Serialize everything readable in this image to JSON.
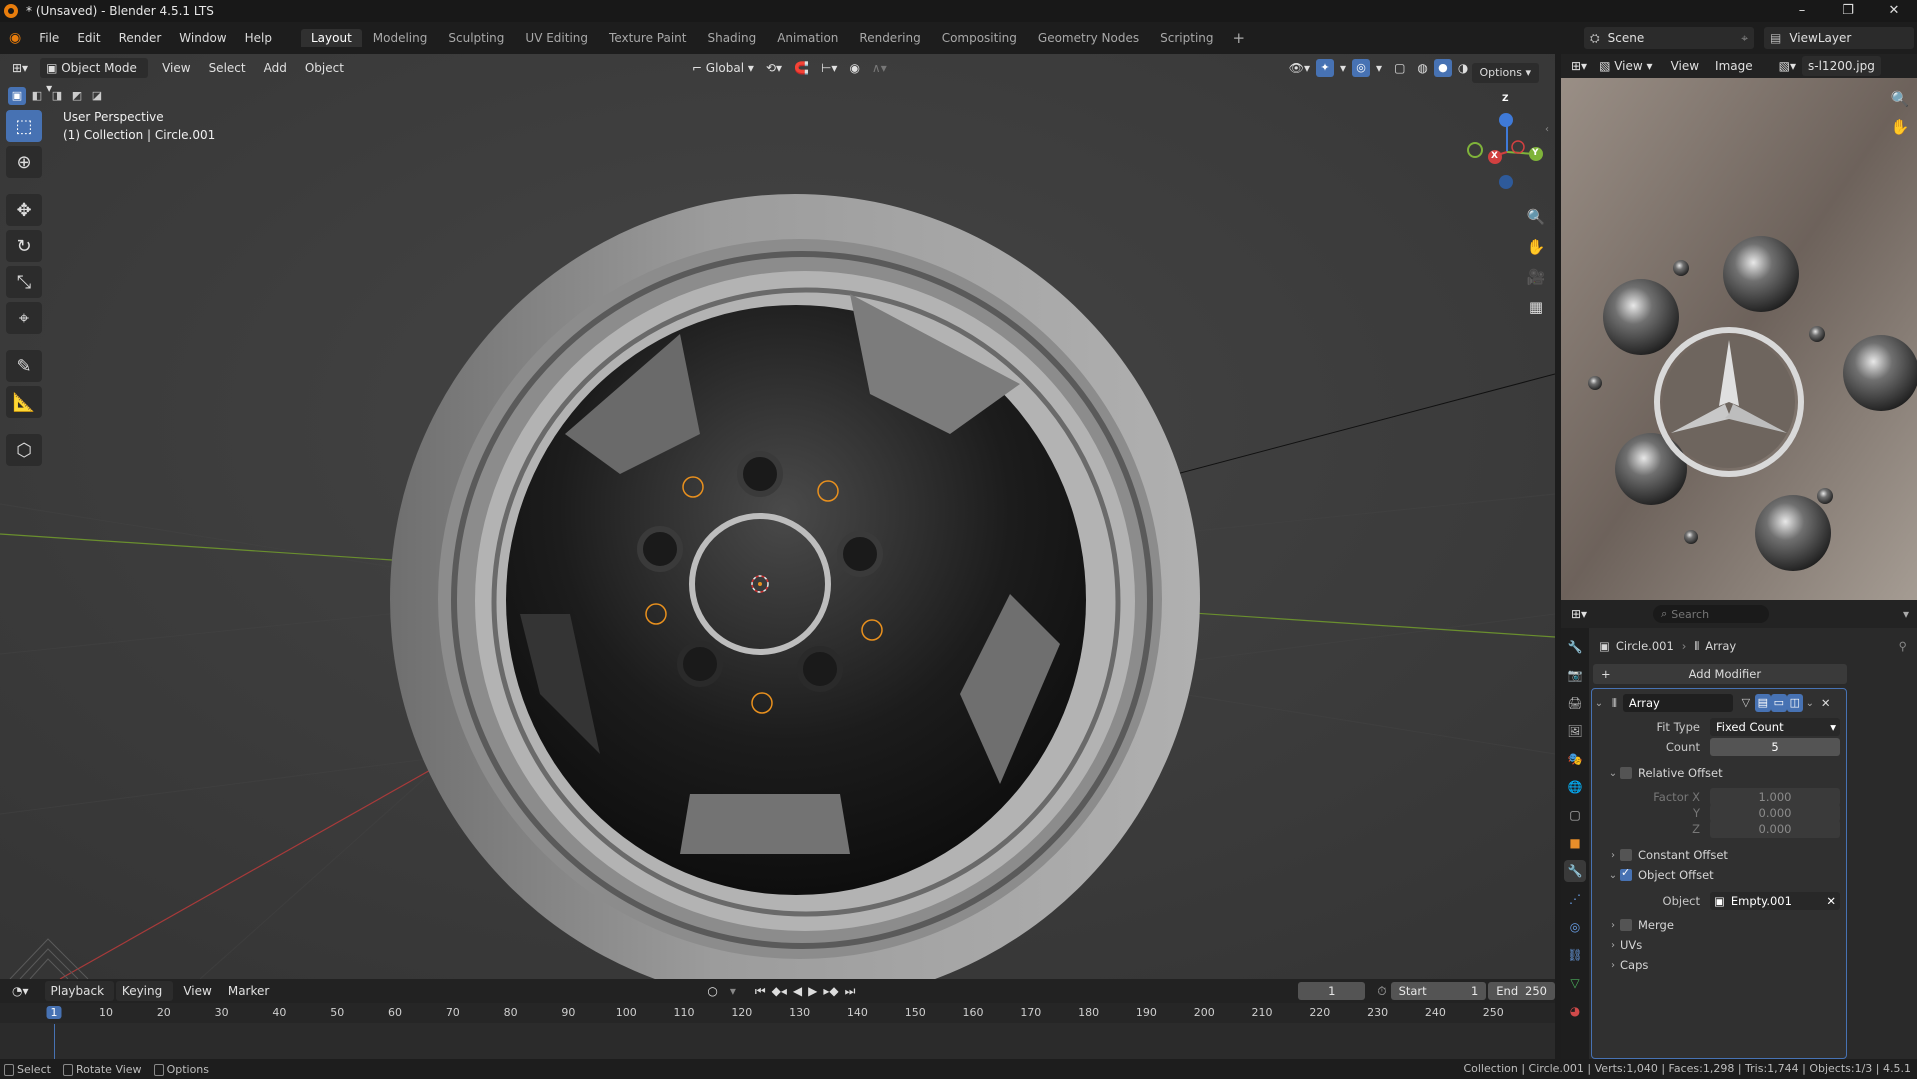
{
  "window": {
    "title": "* (Unsaved) - Blender 4.5.1 LTS",
    "controls": [
      "–",
      "❐",
      "✕"
    ]
  },
  "menu": {
    "items": [
      "File",
      "Edit",
      "Render",
      "Window",
      "Help"
    ],
    "workspaces": [
      "Layout",
      "Modeling",
      "Sculpting",
      "UV Editing",
      "Texture Paint",
      "Shading",
      "Animation",
      "Rendering",
      "Compositing",
      "Geometry Nodes",
      "Scripting"
    ],
    "active_workspace": "Layout",
    "scene": "Scene",
    "view_layer": "ViewLayer"
  },
  "viewport": {
    "mode": "Object Mode",
    "menus": [
      "View",
      "Select",
      "Add",
      "Object"
    ],
    "transform_orientation": "Global",
    "options_label": "Options",
    "info_line1": "User Perspective",
    "info_line2": "(1) Collection | Circle.001",
    "gizmo": {
      "x": "X",
      "y": "Y",
      "z": "Z"
    },
    "colors": {
      "background": "#3c3c3c",
      "x_axis": "#a83a3a",
      "y_axis": "#6a8f2e",
      "selection": "#e8901e"
    }
  },
  "image_editor": {
    "menus": [
      "View",
      "View",
      "Image"
    ],
    "image_name": "s-l1200.jpg"
  },
  "properties": {
    "search_placeholder": "Search",
    "breadcrumb_object": "Circle.001",
    "breadcrumb_modifier": "Array",
    "add_modifier": "Add Modifier",
    "modifier_name": "Array",
    "fit_type_label": "Fit Type",
    "fit_type_value": "Fixed Count",
    "count_label": "Count",
    "count_value": "5",
    "relative_offset": "Relative Offset",
    "relative_offset_enabled": false,
    "factor_x_label": "Factor X",
    "factor_x": "1.000",
    "factor_y_label": "Y",
    "factor_y": "0.000",
    "factor_z_label": "Z",
    "factor_z": "0.000",
    "constant_offset": "Constant Offset",
    "constant_offset_enabled": false,
    "object_offset": "Object Offset",
    "object_offset_enabled": true,
    "object_label": "Object",
    "object_value": "Empty.001",
    "merge": "Merge",
    "uvs": "UVs",
    "caps": "Caps"
  },
  "timeline": {
    "menus": [
      "Playback",
      "Keying",
      "View",
      "Marker"
    ],
    "current_frame": "1",
    "start_label": "Start",
    "start": "1",
    "end_label": "End",
    "end": "250",
    "ticks": [
      "1",
      "10",
      "20",
      "30",
      "40",
      "50",
      "60",
      "70",
      "80",
      "90",
      "100",
      "110",
      "120",
      "130",
      "140",
      "150",
      "160",
      "170",
      "180",
      "190",
      "200",
      "210",
      "220",
      "230",
      "240",
      "250"
    ]
  },
  "statusbar": {
    "select": "Select",
    "rotate_view": "Rotate View",
    "options": "Options",
    "stats": "Collection | Circle.001 | Verts:1,040 | Faces:1,298 | Tris:1,744 | Objects:1/3 | 4.5.1"
  }
}
